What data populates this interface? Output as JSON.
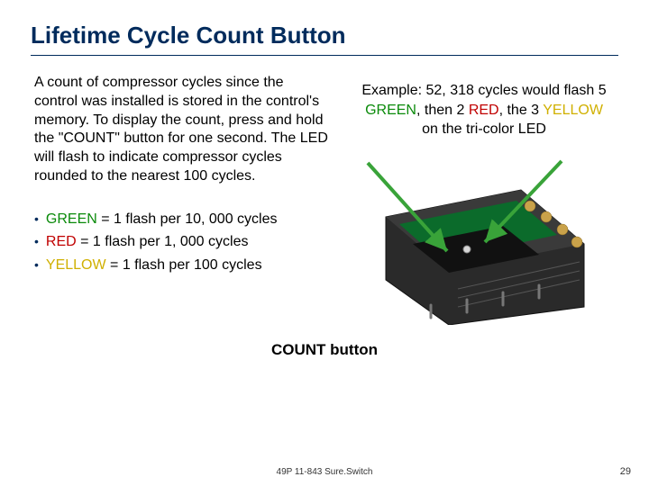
{
  "title": "Lifetime Cycle Count Button",
  "paragraph": "A count of compressor cycles since the control was installed is stored in the control's memory.  To display the count, press and hold the \"COUNT\" button for one second. The LED will flash to indicate compressor cycles rounded to the nearest 100 cycles.",
  "bullets": [
    {
      "color_word": "GREEN",
      "rest": " = 1 flash per 10, 000 cycles",
      "class": "green"
    },
    {
      "color_word": "RED",
      "rest": " = 1 flash per 1, 000 cycles",
      "class": "red"
    },
    {
      "color_word": "YELLOW",
      "rest": " = 1 flash per 100 cycles",
      "class": "yellow"
    }
  ],
  "example": {
    "pre": "Example:  52, 318 cycles would flash 5 ",
    "g": "GREEN",
    "mid1": ", then 2 ",
    "r": "RED",
    "mid2": ", the 3 ",
    "y": "YELLOW",
    "post": " on the tri-color LED"
  },
  "caption": "COUNT button",
  "footer": "49P 11-843 Sure.Switch",
  "page_number": "29"
}
